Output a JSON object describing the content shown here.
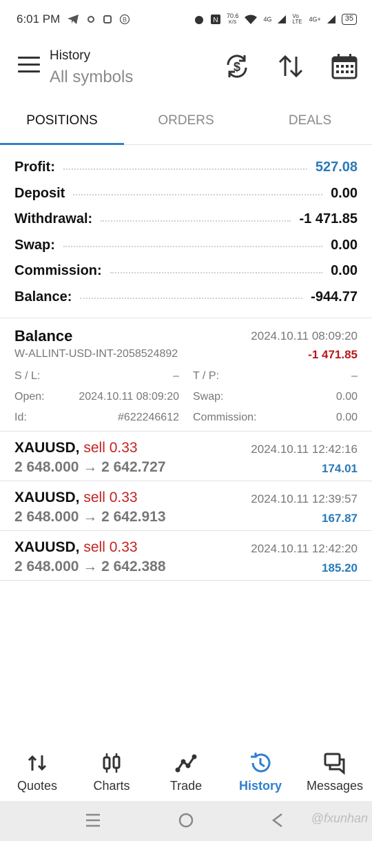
{
  "status_bar": {
    "time": "6:01 PM",
    "net_speed": "70.6",
    "net_unit": "K/S",
    "battery": "35",
    "net_labels": [
      "4G",
      "Vo LTE",
      "4G+"
    ]
  },
  "header": {
    "title": "History",
    "subtitle": "All symbols",
    "icons": [
      "menu-icon",
      "currency-exchange-icon",
      "sort-icon",
      "calendar-icon"
    ]
  },
  "tabs": [
    {
      "label": "POSITIONS",
      "active": true
    },
    {
      "label": "ORDERS",
      "active": false
    },
    {
      "label": "DEALS",
      "active": false
    }
  ],
  "summary": {
    "rows": [
      {
        "label": "Profit:",
        "value": "527.08"
      },
      {
        "label": "Deposit",
        "value": "0.00"
      },
      {
        "label": "Withdrawal:",
        "value": "-1 471.85"
      },
      {
        "label": "Swap:",
        "value": "0.00"
      },
      {
        "label": "Commission:",
        "value": "0.00"
      },
      {
        "label": "Balance:",
        "value": "-944.77"
      }
    ]
  },
  "balance_record": {
    "title": "Balance",
    "time": "2024.10.11 08:09:20",
    "comment": "W-ALLINT-USD-INT-2058524892",
    "amount": "-1 471.85",
    "sl_label": "S / L:",
    "sl_value": "–",
    "tp_label": "T / P:",
    "tp_value": "–",
    "open_label": "Open:",
    "open_value": "2024.10.11 08:09:20",
    "swap_label": "Swap:",
    "swap_value": "0.00",
    "id_label": "Id:",
    "id_value": "#622246612",
    "commission_label": "Commission:",
    "commission_value": "0.00"
  },
  "deals": [
    {
      "symbol": "XAUUSD,",
      "side": "sell 0.33",
      "prices": "2 648.000 → 2 642.727",
      "time": "2024.10.11 12:42:16",
      "profit": "174.01"
    },
    {
      "symbol": "XAUUSD,",
      "side": "sell 0.33",
      "prices": "2 648.000 → 2 642.913",
      "time": "2024.10.11 12:39:57",
      "profit": "167.87"
    },
    {
      "symbol": "XAUUSD,",
      "side": "sell 0.33",
      "prices": "2 648.000 → 2 642.388",
      "time": "2024.10.11 12:42:20",
      "profit": "185.20"
    }
  ],
  "bottom_nav": [
    {
      "label": "Quotes",
      "icon": "quotes-icon"
    },
    {
      "label": "Charts",
      "icon": "charts-icon"
    },
    {
      "label": "Trade",
      "icon": "trade-icon"
    },
    {
      "label": "History",
      "icon": "history-icon",
      "active": true
    },
    {
      "label": "Messages",
      "icon": "messages-icon"
    }
  ],
  "watermark": "@fxunhan",
  "colors": {
    "accent": "#2f7fcf",
    "profit_blue": "#2a7ab8",
    "loss_red": "#b81818",
    "sell_red": "#c42222"
  }
}
